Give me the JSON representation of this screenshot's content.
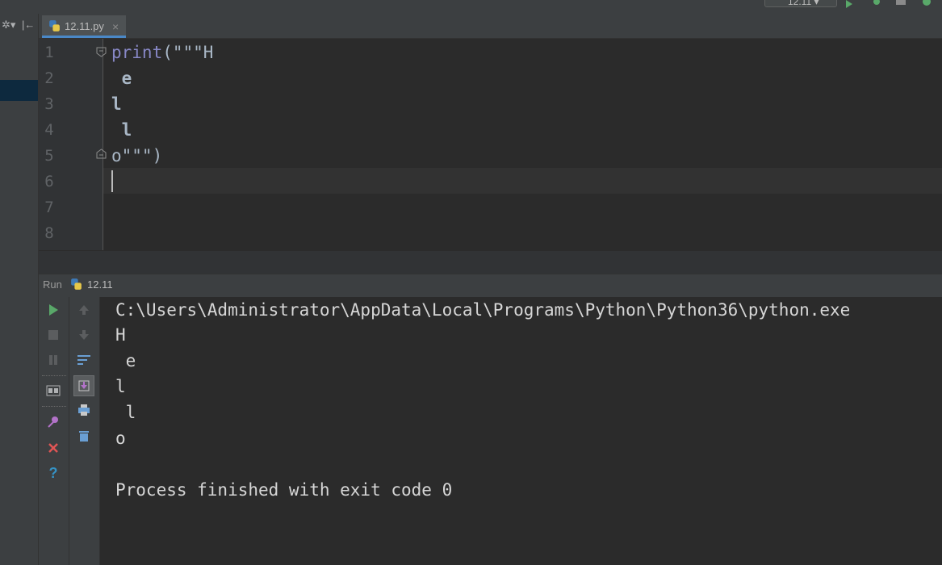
{
  "toolbar": {
    "run_config": "12.11"
  },
  "editor_tab": {
    "filename": "12.11.py"
  },
  "editor": {
    "line_numbers": [
      "1",
      "2",
      "3",
      "4",
      "5",
      "6",
      "7",
      "8"
    ],
    "lines": [
      {
        "builtin": "print",
        "rest": "(\"\"\"H"
      },
      {
        "builtin": "",
        "rest": " e"
      },
      {
        "builtin": "",
        "rest": "l"
      },
      {
        "builtin": "",
        "rest": " l"
      },
      {
        "builtin": "",
        "rest": "o\"\"\")"
      }
    ]
  },
  "run_panel": {
    "title": "Run",
    "config_name": "12.11"
  },
  "console": {
    "command": "C:\\Users\\Administrator\\AppData\\Local\\Programs\\Python\\Python36\\python.exe",
    "output": [
      "H",
      " e",
      "l",
      " l",
      "o"
    ],
    "exit_message": "Process finished with exit code 0"
  },
  "colors": {
    "accent": "#4a88c7",
    "run_green": "#59a869",
    "stop_red": "#e05555",
    "help_blue": "#3592c4"
  }
}
